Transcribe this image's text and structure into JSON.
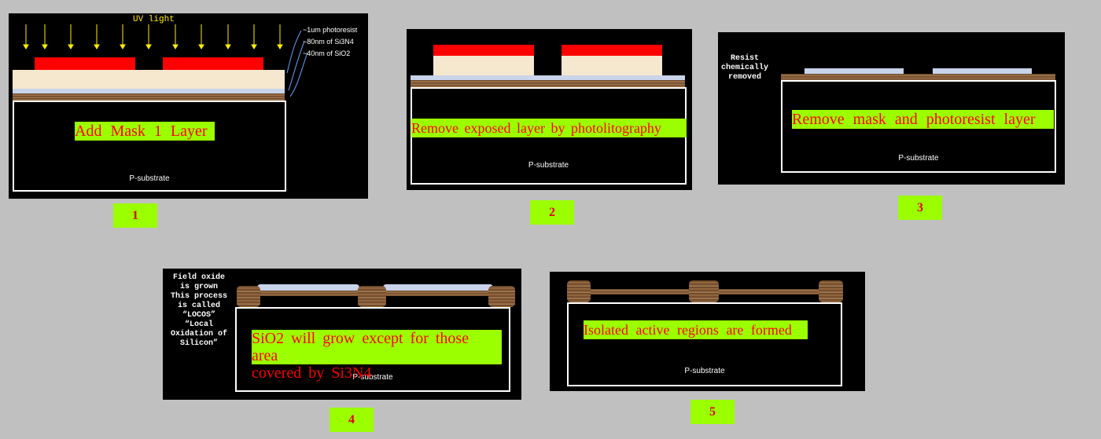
{
  "panel1": {
    "uv_label": "UV light",
    "layer_labels": [
      "~1um photoresist",
      "~80nm of Si3N4",
      "~40nm of SiO2"
    ],
    "caption": "Add Mask 1 Layer",
    "substrate": "P-substrate",
    "number": "1"
  },
  "panel2": {
    "caption": "Remove exposed layer by photolitography",
    "substrate": "P-substrate",
    "number": "2"
  },
  "panel3": {
    "side_text": [
      "Resist",
      "chemically",
      "removed"
    ],
    "caption": "Remove mask and photoresist layer",
    "substrate": "P-substrate",
    "number": "3"
  },
  "panel4": {
    "side_text": [
      "Field oxide",
      "is grown",
      "This process",
      "is called",
      "“LOCOS”",
      "“Local",
      "Oxidation of",
      "Silicon”"
    ],
    "caption": [
      "SiO2 will grow except for those area",
      "covered by Si3N4"
    ],
    "substrate": "P-substrate",
    "number": "4"
  },
  "panel5": {
    "caption": "Isolated active regions are formed",
    "substrate": "P-substrate",
    "number": "5"
  },
  "colors": {
    "background": "#c0c0c0",
    "panel": "#000000",
    "caption_bg": "#9bff00",
    "caption_text": "#ff0000",
    "mask": "#ff0000",
    "resist": "#f6e7cf",
    "nitride": "#c9d3ea",
    "uv": "#ffee00"
  }
}
